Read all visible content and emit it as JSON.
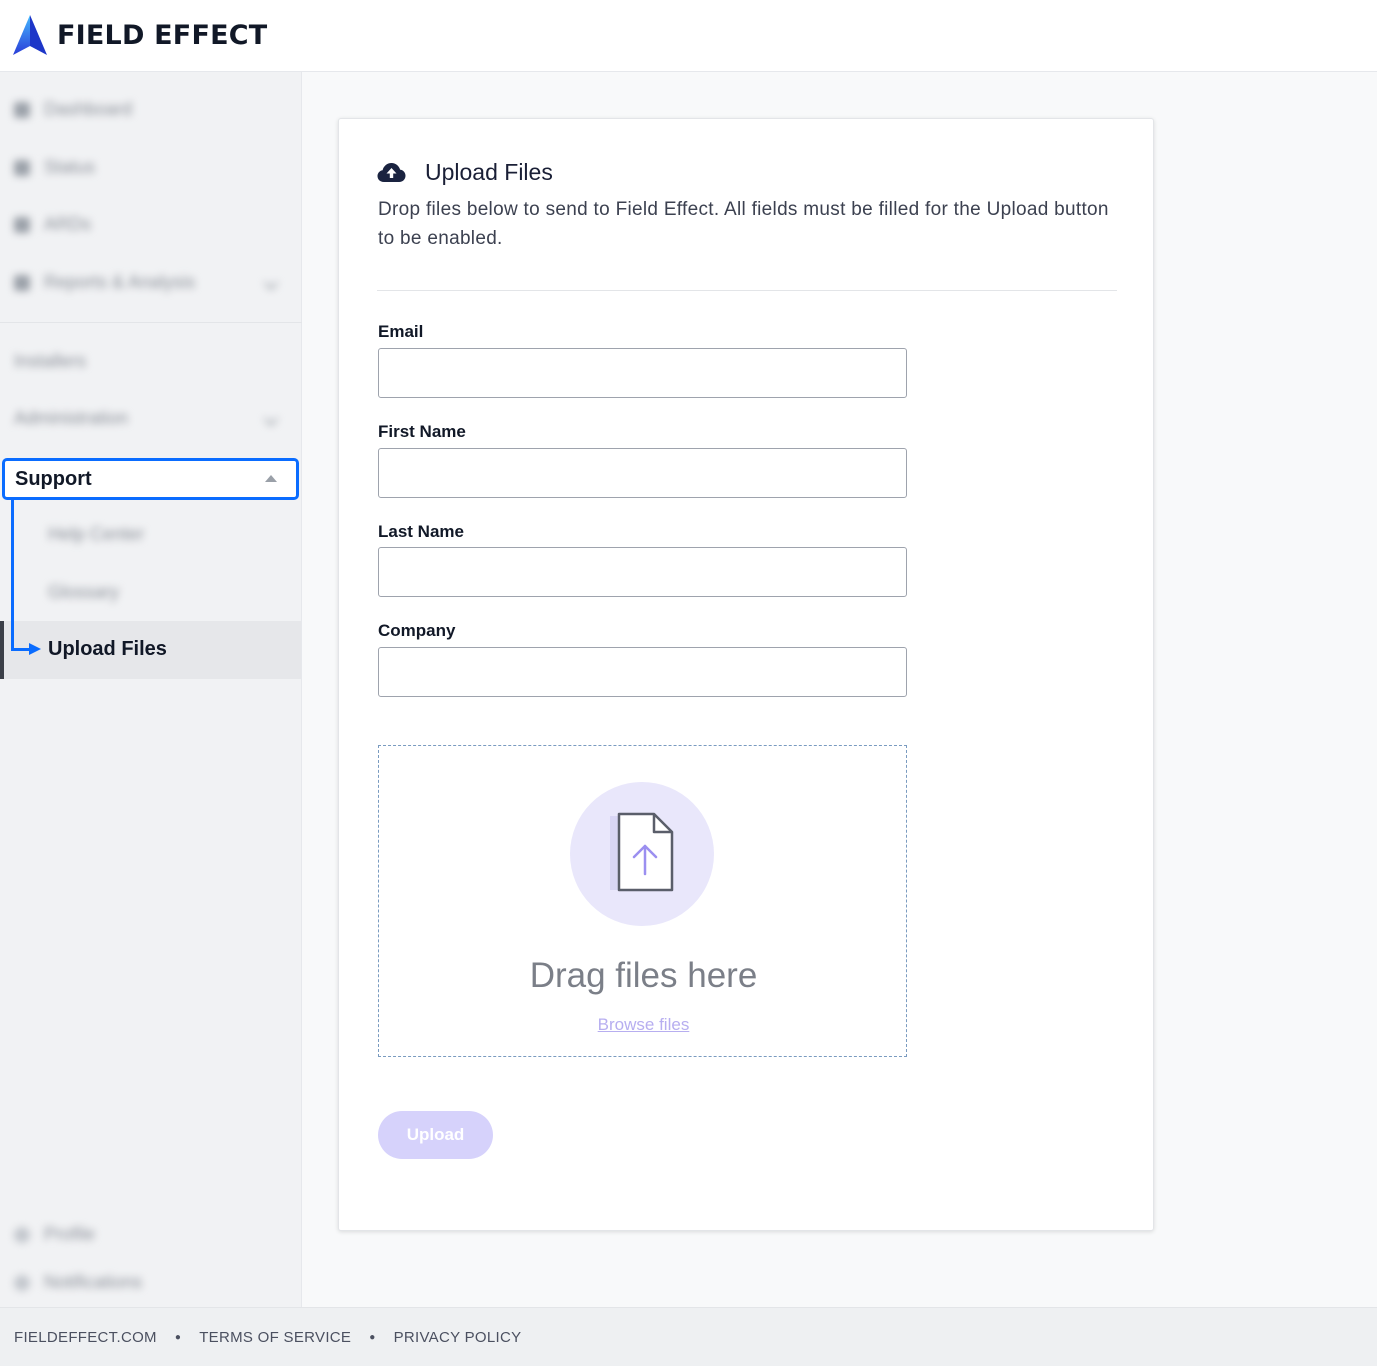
{
  "header": {
    "logo_text": "FIELD EFFECT"
  },
  "sidebar": {
    "items": [
      {
        "label": "Dashboard"
      },
      {
        "label": "Status"
      },
      {
        "label": "ARDs"
      },
      {
        "label": "Reports & Analysis"
      }
    ],
    "sections": [
      {
        "label": "Installers"
      },
      {
        "label": "Administration"
      }
    ],
    "support": {
      "label": "Support",
      "children": [
        {
          "label": "Help Center"
        },
        {
          "label": "Glossary"
        },
        {
          "label": "Upload Files"
        }
      ]
    },
    "bottom": [
      {
        "label": "Profile"
      },
      {
        "label": "Notifications"
      }
    ]
  },
  "card": {
    "title": "Upload Files",
    "description": "Drop files below to send to Field Effect. All fields must be filled for the Upload button to be enabled.",
    "fields": {
      "email_label": "Email",
      "first_name_label": "First Name",
      "last_name_label": "Last Name",
      "company_label": "Company"
    },
    "dropzone": {
      "text": "Drag files here",
      "browse": "Browse files"
    },
    "upload_label": "Upload"
  },
  "footer": {
    "links": [
      "FIELDEFFECT.COM",
      "TERMS OF SERVICE",
      "PRIVACY POLICY"
    ]
  },
  "colors": {
    "highlight": "#0a6cff",
    "button_disabled": "#d6d2fb",
    "dropzone_circle": "#e9e7fb"
  }
}
